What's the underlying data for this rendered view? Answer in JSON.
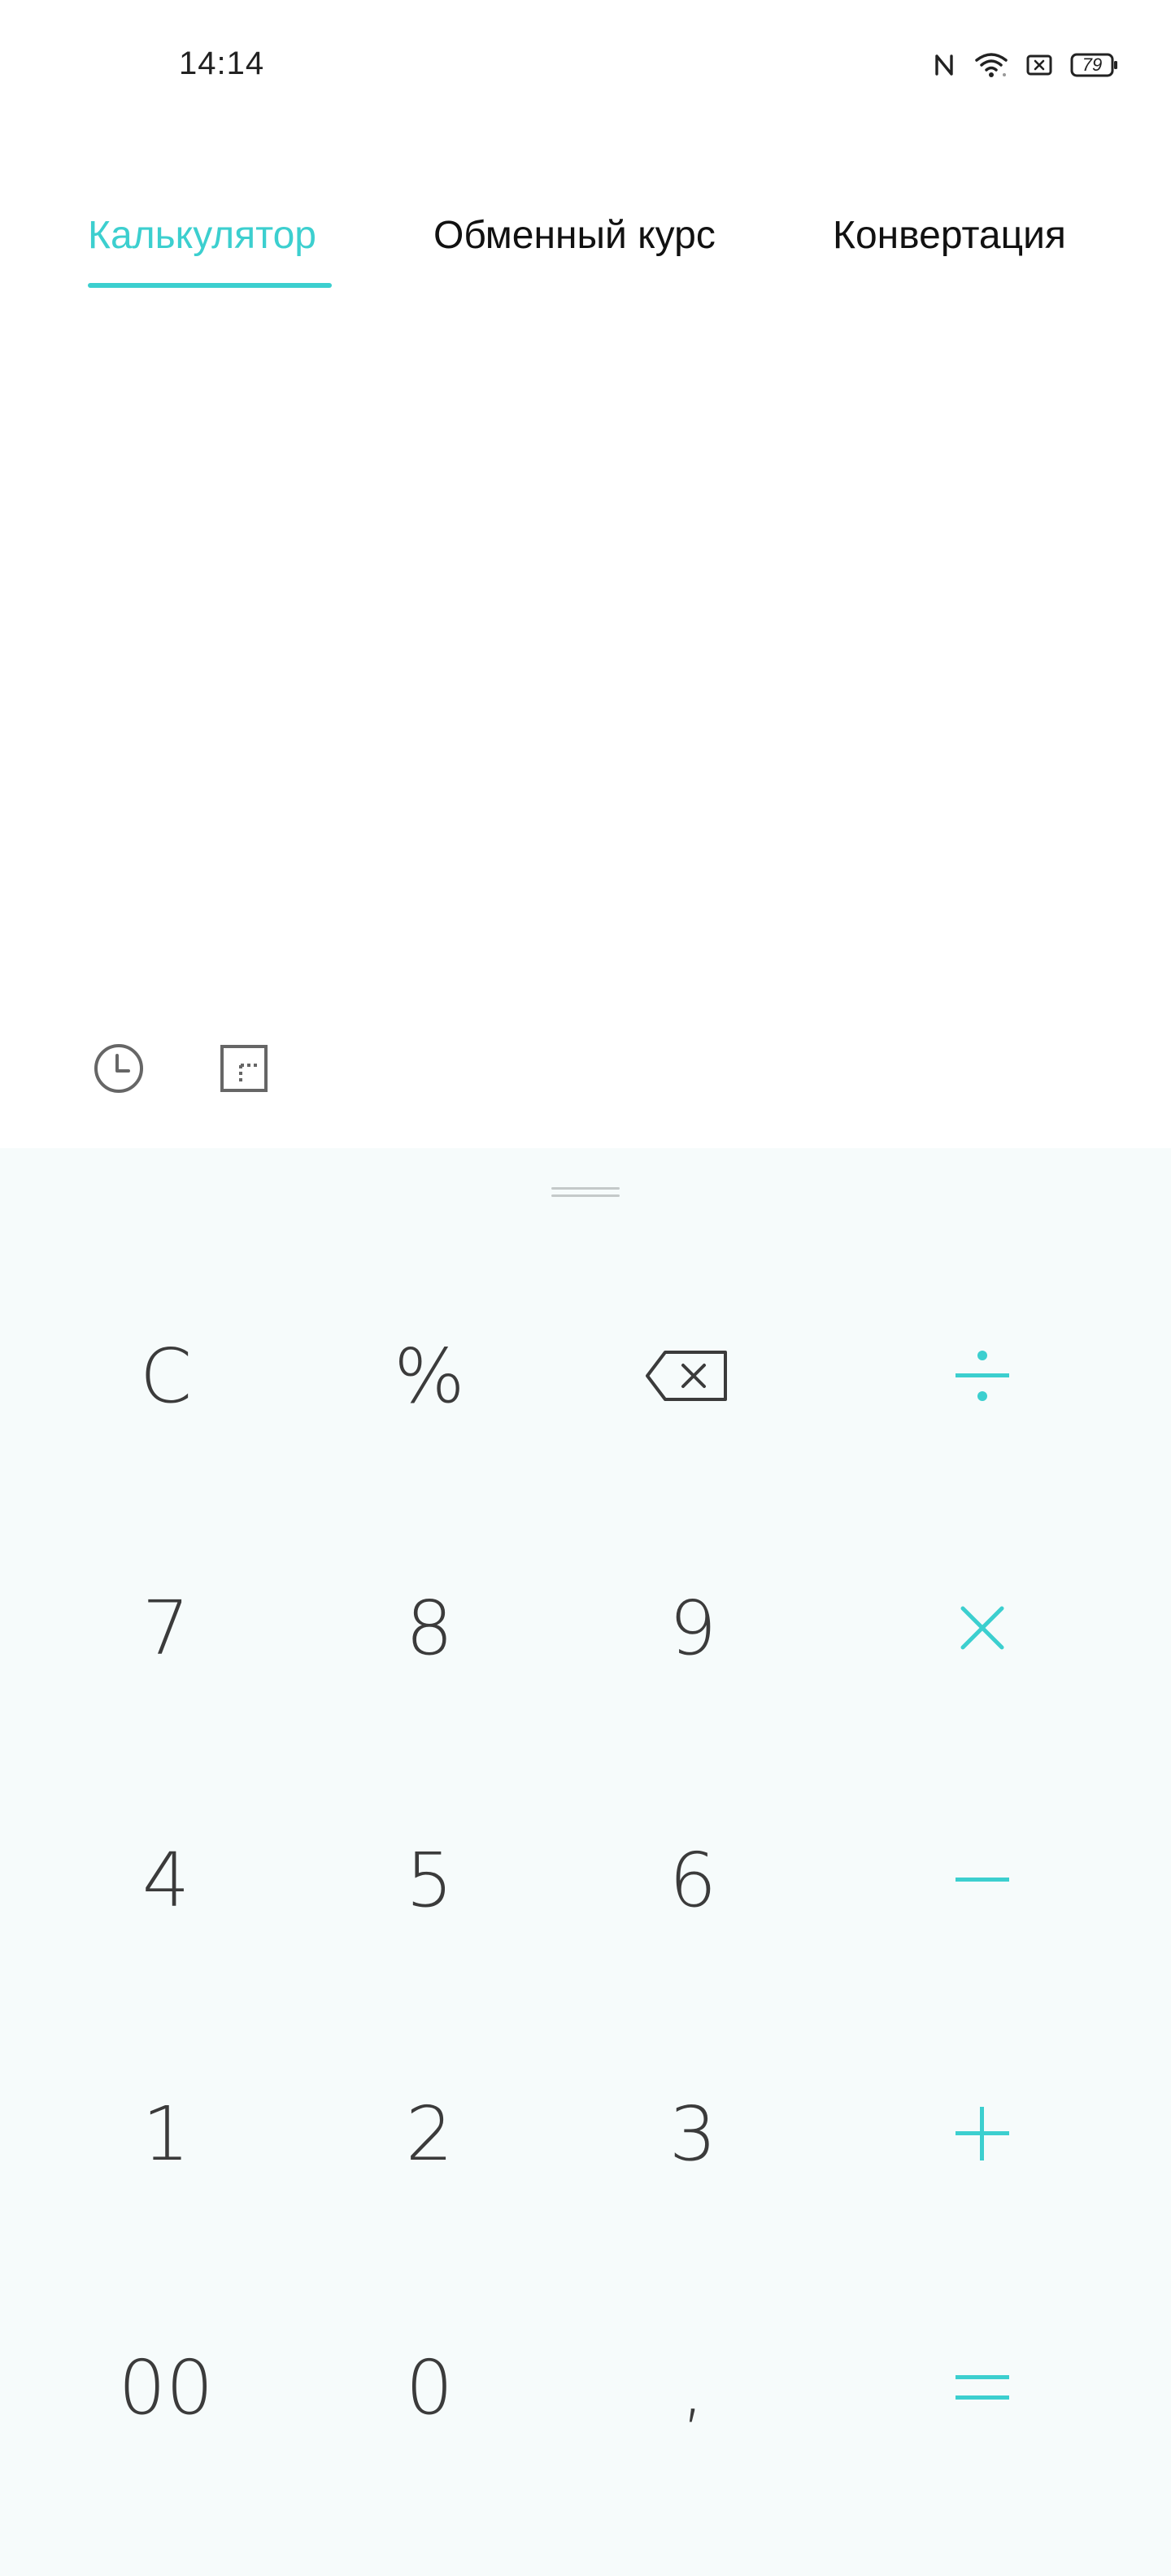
{
  "status_bar": {
    "time": "14:14",
    "battery": "79",
    "icons": [
      "nfc-icon",
      "wifi-icon",
      "sim-off-icon",
      "battery-icon"
    ]
  },
  "tabs": [
    {
      "label": "Калькулятор",
      "active": true
    },
    {
      "label": "Обменный курс",
      "active": false
    },
    {
      "label": "Конвертация",
      "active": false
    }
  ],
  "tools": [
    "history-icon",
    "scientific-mode-icon"
  ],
  "colors": {
    "accent": "#3ccfcf",
    "key_text": "#3b3b3b",
    "keypad_bg": "#f6fbfb"
  },
  "keypad": {
    "clear": "C",
    "percent": "%",
    "backspace": "backspace-icon",
    "divide": "÷",
    "multiply": "×",
    "minus": "−",
    "plus": "+",
    "equals": "=",
    "digits": {
      "seven": "7",
      "eight": "8",
      "nine": "9",
      "four": "4",
      "five": "5",
      "six": "6",
      "one": "1",
      "two": "2",
      "three": "3",
      "double_zero": "00",
      "zero": "0",
      "comma": ","
    }
  }
}
